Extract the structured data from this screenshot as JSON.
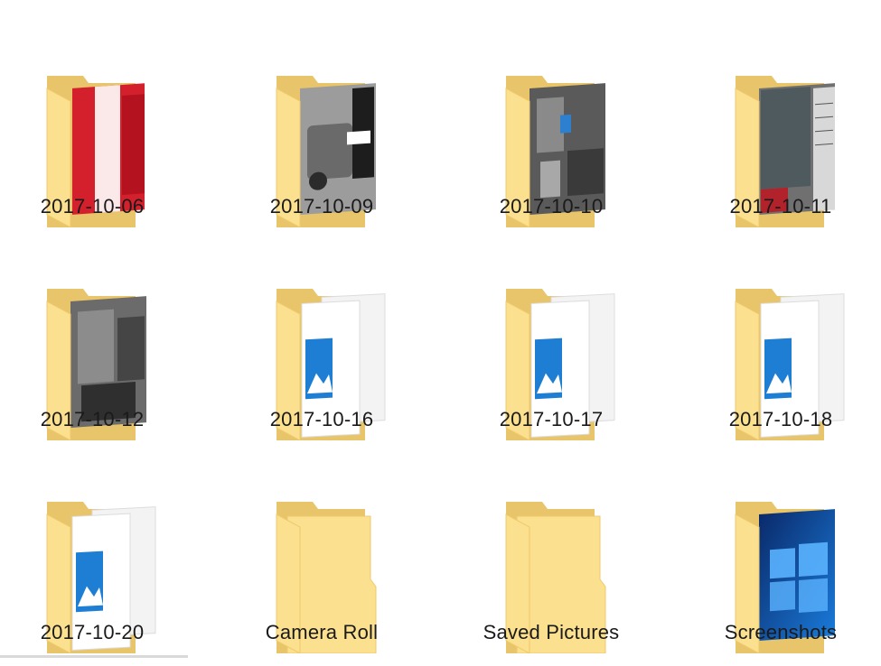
{
  "folders": [
    {
      "label": "2017-10-06",
      "preview": "red-car-photo",
      "icon": "folder-photo-icon"
    },
    {
      "label": "2017-10-09",
      "preview": "grey-car-photo",
      "icon": "folder-photo-icon"
    },
    {
      "label": "2017-10-10",
      "preview": "engine-photo",
      "icon": "folder-photo-icon"
    },
    {
      "label": "2017-10-11",
      "preview": "document-photo",
      "icon": "folder-photo-icon"
    },
    {
      "label": "2017-10-12",
      "preview": "engine-closeup-photo",
      "icon": "folder-photo-icon"
    },
    {
      "label": "2017-10-16",
      "preview": "image-placeholder",
      "icon": "folder-image-icon"
    },
    {
      "label": "2017-10-17",
      "preview": "image-placeholder",
      "icon": "folder-image-icon"
    },
    {
      "label": "2017-10-18",
      "preview": "image-placeholder",
      "icon": "folder-image-icon"
    },
    {
      "label": "2017-10-20",
      "preview": "image-placeholder",
      "icon": "folder-image-icon"
    },
    {
      "label": "Camera Roll",
      "preview": "empty",
      "icon": "folder-icon"
    },
    {
      "label": "Saved Pictures",
      "preview": "empty",
      "icon": "folder-icon"
    },
    {
      "label": "Screenshots",
      "preview": "windows-wallpaper",
      "icon": "folder-photo-icon"
    }
  ],
  "colors": {
    "folder_back": "#e8c46a",
    "folder_front": "#fbe08f",
    "folder_edge": "#f5d27a",
    "placeholder_blue": "#1e7ed3"
  }
}
